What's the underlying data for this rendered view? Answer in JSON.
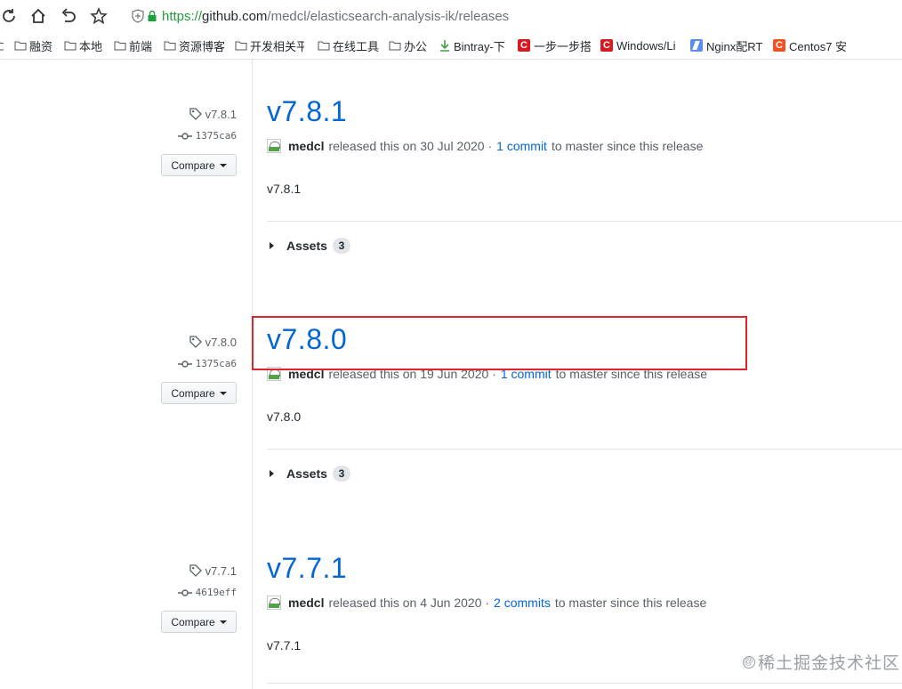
{
  "browser": {
    "url": {
      "scheme": "https://",
      "host": "github.com",
      "path": "/medcl/elasticsearch-analysis-ik/releases"
    },
    "bookmarks": [
      {
        "label": "融资",
        "icon": "folder-icon"
      },
      {
        "label": "本地",
        "icon": "folder-icon"
      },
      {
        "label": "前端",
        "icon": "folder-icon"
      },
      {
        "label": "资源博客",
        "icon": "folder-icon"
      },
      {
        "label": "开发相关平",
        "icon": "folder-icon"
      },
      {
        "label": "在线工具",
        "icon": "folder-icon"
      },
      {
        "label": "办公",
        "icon": "folder-icon"
      },
      {
        "label": "Bintray-下",
        "icon": "bintray-icon"
      },
      {
        "label": "一步一步搭",
        "icon": "csdn-icon",
        "icon_text": "C"
      },
      {
        "label": "Windows/Li",
        "icon": "csdn-icon",
        "icon_text": "C"
      },
      {
        "label": "Nginx配RT",
        "icon": "blog-icon"
      },
      {
        "label": "Centos7 安",
        "icon": "csdn-icon",
        "icon_text": "C"
      }
    ]
  },
  "releases": [
    {
      "tag": "v7.8.1",
      "commit": "1375ca6",
      "compare_label": "Compare",
      "title": "v7.8.1",
      "author": "medcl",
      "released_text": "released this on 30 Jul 2020 ·",
      "commits_link": "1 commit",
      "since_text": "to master since this release",
      "body": "v7.8.1",
      "assets_label": "Assets",
      "assets_count": "3"
    },
    {
      "tag": "v7.8.0",
      "commit": "1375ca6",
      "compare_label": "Compare",
      "title": "v7.8.0",
      "author": "medcl",
      "released_text": "released this on 19 Jun 2020 ·",
      "commits_link": "1 commit",
      "since_text": "to master since this release",
      "body": "v7.8.0",
      "assets_label": "Assets",
      "assets_count": "3"
    },
    {
      "tag": "v7.7.1",
      "commit": "4619eff",
      "compare_label": "Compare",
      "title": "v7.7.1",
      "author": "medcl",
      "released_text": "released this on 4 Jun 2020 ·",
      "commits_link": "2 commits",
      "since_text": "to master since this release",
      "body": "v7.7.1"
    }
  ],
  "watermark": {
    "text": "稀土掘金技术社区",
    "symbol": "@"
  },
  "colors": {
    "link": "#0366d6",
    "highlight_border": "#e0262d",
    "secure": "#1f9e3e"
  }
}
